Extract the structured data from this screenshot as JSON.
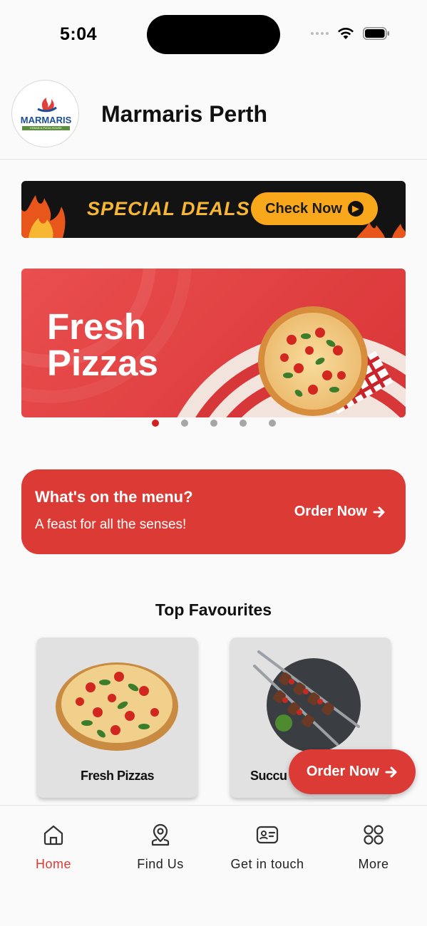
{
  "status_bar": {
    "time": "5:04",
    "icons": [
      "signal-dots-icon",
      "wifi-icon",
      "battery-icon"
    ]
  },
  "header": {
    "logo_text": "MARMARIS",
    "logo_subtext": "KEBAB & PIZZA HOUSE",
    "title": "Marmaris Perth"
  },
  "deals_banner": {
    "text": "SPECIAL DEALS",
    "button_label": "Check Now"
  },
  "hero": {
    "title": "Fresh Pizzas",
    "slide_count": 5,
    "active_slide": 1
  },
  "menu_promo": {
    "title": "What's on the menu?",
    "subtitle": "A feast for all the senses!",
    "action_label": "Order Now"
  },
  "favourites": {
    "title": "Top Favourites",
    "items": [
      {
        "label": "Fresh Pizzas"
      },
      {
        "label": "Succu"
      }
    ]
  },
  "fab": {
    "label": "Order Now"
  },
  "bottom_nav": {
    "active": "Home",
    "items": [
      {
        "label": "Home",
        "icon": "home-icon"
      },
      {
        "label": "Find Us",
        "icon": "location-pin-icon"
      },
      {
        "label": "Get in touch",
        "icon": "contact-card-icon"
      },
      {
        "label": "More",
        "icon": "grid-icon"
      }
    ]
  },
  "colors": {
    "accent_red": "#dc3b35",
    "deals_orange": "#f9a81b",
    "active_dot": "#d31f1f"
  }
}
